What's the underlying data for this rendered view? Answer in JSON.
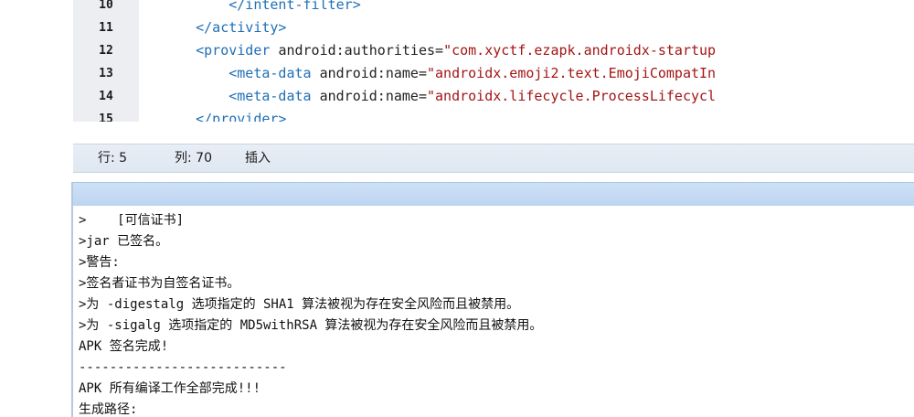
{
  "editor": {
    "lines": [
      {
        "num": "10",
        "indent": "        ",
        "parts": [
          [
            "tag",
            "</intent-filter>"
          ]
        ]
      },
      {
        "num": "11",
        "indent": "    ",
        "parts": [
          [
            "tag",
            "</activity>"
          ]
        ]
      },
      {
        "num": "12",
        "indent": "    ",
        "parts": [
          [
            "tag",
            "<provider "
          ],
          [
            "attr",
            "android:authorities="
          ],
          [
            "val",
            "\"com.xyctf.ezapk.androidx-startup"
          ]
        ]
      },
      {
        "num": "13",
        "indent": "        ",
        "parts": [
          [
            "tag",
            "<meta-data "
          ],
          [
            "attr",
            "android:name="
          ],
          [
            "val",
            "\"androidx.emoji2.text.EmojiCompatIn"
          ]
        ]
      },
      {
        "num": "14",
        "indent": "        ",
        "parts": [
          [
            "tag",
            "<meta-data "
          ],
          [
            "attr",
            "android:name="
          ],
          [
            "val",
            "\"androidx.lifecycle.ProcessLifecycl"
          ]
        ]
      },
      {
        "num": "15",
        "indent": "    ",
        "parts": [
          [
            "tag",
            "</provider>"
          ]
        ]
      }
    ]
  },
  "status": {
    "row": "行: 5",
    "col": "列: 70",
    "mode": "插入"
  },
  "console": {
    "lines": [
      ">    [可信证书]",
      ">jar 已签名。",
      ">警告:",
      ">签名者证书为自签名证书。",
      ">为 -digestalg 选项指定的 SHA1 算法被视为存在安全风险而且被禁用。",
      ">为 -sigalg 选项指定的 MD5withRSA 算法被视为存在安全风险而且被禁用。",
      "APK 签名完成!",
      "---------------------------",
      "APK 所有编译工作全部完成!!!",
      "生成路径:"
    ]
  }
}
